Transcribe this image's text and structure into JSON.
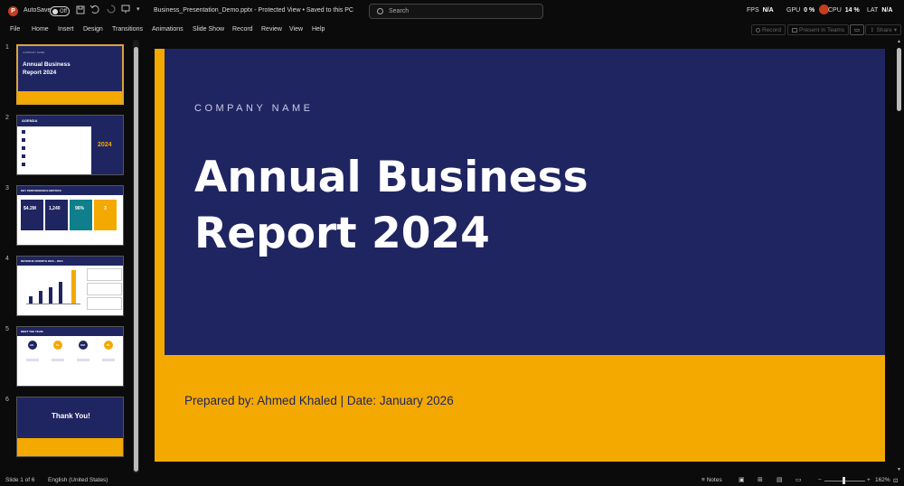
{
  "titlebar": {
    "logo_letter": "P",
    "autosave_label": "AutoSave",
    "autosave_state": "Off",
    "filename": "Business_Presentation_Demo.pptx  -  Protected View • Saved to this PC",
    "search_placeholder": "Search",
    "fps_label": "FPS",
    "fps_value": "N/A",
    "gpu_label": "GPU",
    "gpu_value": "0 %",
    "cpu_label": "CPU",
    "cpu_value": "14 %",
    "lat_label": "LAT",
    "lat_value": "N/A"
  },
  "ribbon": {
    "tabs": [
      "File",
      "Home",
      "Insert",
      "Design",
      "Transitions",
      "Animations",
      "Slide Show",
      "Record",
      "Review",
      "View",
      "Help"
    ],
    "record_button": "Record",
    "present_button": "Present in Teams",
    "share_button": "Share"
  },
  "slides": [
    {
      "number": "1",
      "title": "Annual Business Report 2024",
      "small": "COMPANY NAME"
    },
    {
      "number": "2",
      "title": "AGENDA",
      "year": "2024"
    },
    {
      "number": "3",
      "title": "KEY PERFORMANCE METRICS",
      "metrics": [
        "$4.2M",
        "1,240",
        "96%",
        "3"
      ]
    },
    {
      "number": "4",
      "title": "REVENUE GROWTH 2020 – 2024"
    },
    {
      "number": "5",
      "title": "MEET THE TEAM",
      "initials": [
        "AK",
        "SL",
        "OM",
        "RL"
      ]
    },
    {
      "number": "6",
      "title": "Thank You!"
    }
  ],
  "main_slide": {
    "company": "COMPANY NAME",
    "title_line1": "Annual Business",
    "title_line2": "Report 2024",
    "prepared": "Prepared by: Ahmed Khaled  |  Date: January 2026"
  },
  "statusbar": {
    "slide_info": "Slide 1 of 6",
    "language": "English (United States)",
    "notes": "Notes",
    "zoom": "162%"
  },
  "colors": {
    "navy": "#1f2561",
    "gold": "#f4a900",
    "teal": "#0f7f8c"
  }
}
